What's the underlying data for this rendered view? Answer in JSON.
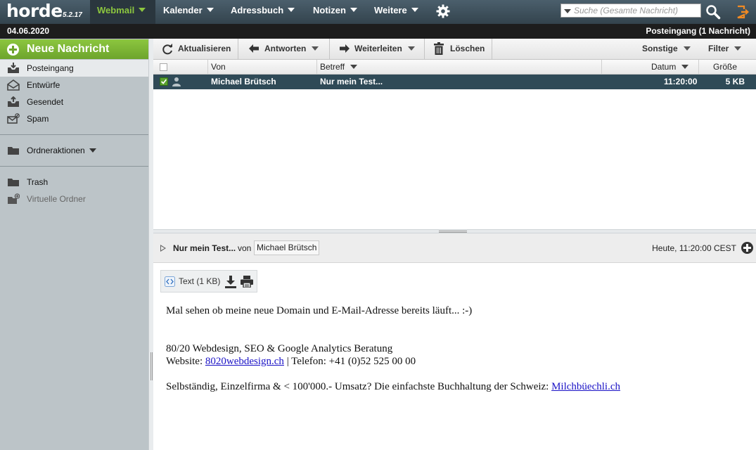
{
  "app": {
    "logo": "horde",
    "version": "5.2.17"
  },
  "nav": {
    "webmail": "Webmail",
    "kalender": "Kalender",
    "adressbuch": "Adressbuch",
    "notizen": "Notizen",
    "weitere": "Weitere"
  },
  "search": {
    "placeholder": "Suche (Gesamte Nachricht)"
  },
  "datebar": {
    "date": "04.06.2020",
    "folder_status": "Posteingang (1 Nachricht)"
  },
  "sidebar": {
    "new_message": "Neue Nachricht",
    "folders": [
      {
        "label": "Posteingang",
        "icon": "inbox-icon"
      },
      {
        "label": "Entwürfe",
        "icon": "drafts-icon"
      },
      {
        "label": "Gesendet",
        "icon": "sent-icon"
      },
      {
        "label": "Spam",
        "icon": "spam-icon"
      }
    ],
    "folder_actions": "Ordneraktionen",
    "trash": "Trash",
    "virtual_folders": "Virtuelle Ordner"
  },
  "toolbar": {
    "refresh": "Aktualisieren",
    "reply": "Antworten",
    "forward": "Weiterleiten",
    "delete": "Löschen",
    "other": "Sonstige",
    "filter": "Filter"
  },
  "list": {
    "columns": {
      "from": "Von",
      "subject": "Betreff",
      "date": "Datum",
      "size": "Größe"
    },
    "messages": [
      {
        "from": "Michael Brütsch",
        "subject": "Nur mein Test...",
        "date": "11:20:00",
        "size": "5 KB",
        "selected": true
      }
    ]
  },
  "preview": {
    "subject": "Nur mein Test...",
    "von": "von",
    "sender": "Michael Brütsch",
    "date": "Heute, 11:20:00 CEST",
    "attachment": "Text (1 KB)",
    "body": {
      "line1": "Mal sehen ob meine neue Domain und E-Mail-Adresse bereits läuft... :-)",
      "sig1": "80/20 Webdesign, SEO & Google Analytics Beratung",
      "sig2_prefix": "Website: ",
      "sig2_link": "8020webdesign.ch",
      "sig2_suffix": " | Telefon: +41 (0)52 525 00 00",
      "sig3_prefix": "Selbständig, Einzelfirma & < 100'000.- Umsatz? Die einfachste Buchhaltung der Schweiz: ",
      "sig3_link": "Milchbüechli.ch"
    }
  },
  "colors": {
    "accent_green": "#8cc63f",
    "topbar": "#3f505b",
    "selected_row": "#2f4a57",
    "sidebar": "#bcc4c8",
    "link": "#1a12c6"
  }
}
